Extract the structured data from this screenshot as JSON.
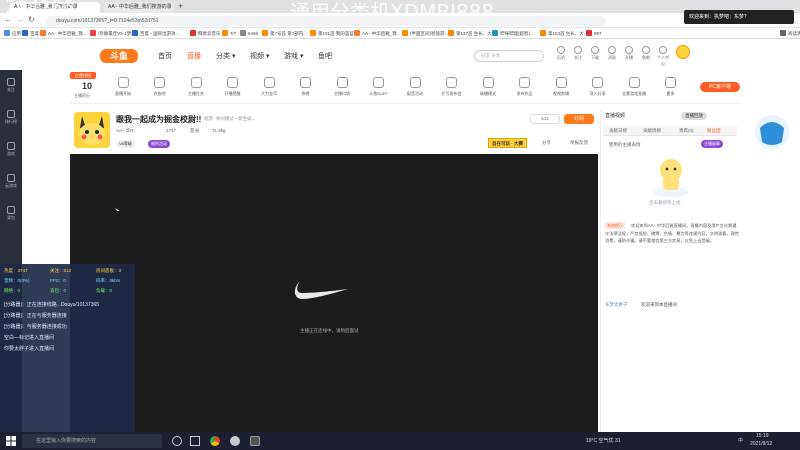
{
  "browser": {
    "tabs": [
      {
        "label": "AA - 中华后雅_我们搜游的录"
      },
      {
        "label": "AA - 中华后雅_我们搜游的录"
      }
    ],
    "new_tab": "+",
    "url": "douyu.com/10137365?_t=0.7124e53m52d751"
  },
  "overlay": {
    "top_number": "204266",
    "top_text": "通用分类机XDMBJ888"
  },
  "notification": {
    "label": "欢迎来到：",
    "name": "执梦吧：东梦？"
  },
  "bookmarks": [
    {
      "label": "应用",
      "color": "#4a8af4"
    },
    {
      "label": "百度",
      "color": "#2a62d4"
    },
    {
      "label": "AA - 中华后雅_我...",
      "color": "#ff7a2d"
    },
    {
      "label": "/奈静最佳V5-1梦想...",
      "color": "#e44"
    },
    {
      "label": "百度 - 国际出游攻...",
      "color": "#2a62d4"
    },
    {
      "label": "网易云音乐",
      "color": "#d33"
    },
    {
      "label": "7/7",
      "color": "#f80"
    },
    {
      "label": "6466",
      "color": "#888"
    },
    {
      "label": "第7号首 第7部内...",
      "color": "#f80"
    },
    {
      "label": "第101首 我的蓝蓝...",
      "color": "#f80"
    },
    {
      "label": "AA - 中华后雅_我...",
      "color": "#ff7a2d"
    },
    {
      "label": "(半面区间)智能游...",
      "color": "#f80"
    },
    {
      "label": "第137首 生长、大...",
      "color": "#f80"
    },
    {
      "label": "哔咪哔哩(超智)...",
      "color": "#29a"
    },
    {
      "label": "第153首 生长、大...",
      "color": "#f80"
    },
    {
      "label": "897",
      "color": "#d33"
    },
    {
      "label": "阅读清单",
      "color": "#666"
    }
  ],
  "site": {
    "logo": "斗鱼",
    "nav": [
      {
        "label": "首页",
        "active": false
      },
      {
        "label": "直播",
        "active": true
      },
      {
        "label": "分类 ▾",
        "active": false
      },
      {
        "label": "视频 ▾",
        "active": false
      },
      {
        "label": "游戏 ▾",
        "active": false
      },
      {
        "label": "鱼吧",
        "active": false
      }
    ],
    "search_placeholder": "好友 分享...",
    "header_icons": [
      "历史",
      "关注",
      "下载",
      "消息",
      "开播",
      "鱼吧",
      "个人中心"
    ]
  },
  "category_bar": {
    "rank_badge": "亿赞排榜",
    "rank_number": "10",
    "rank_label": "主播积分",
    "items": [
      "直播开始",
      "亦鱼吧",
      "主播任务",
      "开播提醒",
      "大力金币",
      "热榜",
      "主播口袋",
      "斗鱼BUFF",
      "配音活动",
      "扩写发布会",
      "联播模式",
      "发布作品",
      "视频剪辑",
      "导入分享",
      "全景游戏直播",
      "更多"
    ],
    "pc_button": "PC客户端"
  },
  "room": {
    "title": "跟我一起成为掘金校尉!!",
    "category": "端游",
    "tags": "休闲模式 • 新生娱...",
    "host": "AA - 华R",
    "viewers": "3747",
    "fans": "亚洲",
    "likes": "71.6kg",
    "badge1": "V6等级",
    "badge2": "福利活动",
    "promo": "自在可玩 · 大赛",
    "share": "分享",
    "report": "举报反馈",
    "subscribe_count": "512",
    "follow": "订阅"
  },
  "video": {
    "loading_text": "主播正在连线中，请稍后面试"
  },
  "sidebar_left": [
    {
      "label": "关注"
    },
    {
      "label": "排行榜"
    },
    {
      "label": "游戏"
    },
    {
      "label": "云游戏"
    },
    {
      "label": "背包"
    }
  ],
  "stats": {
    "row1": [
      {
        "k": "热度：",
        "v": "3747"
      },
      {
        "k": "关注：",
        "v": "513"
      },
      {
        "k": "房间底板：",
        "v": "3"
      }
    ],
    "row2": [
      {
        "k": "音频：",
        "v": "0(0%)"
      },
      {
        "k": "FPS：",
        "v": "0"
      },
      {
        "k": "码率：",
        "v": "0kb/s"
      }
    ],
    "row3": [
      {
        "k": "网络：",
        "v": "0"
      },
      {
        "k": "丢包：",
        "v": "0"
      },
      {
        "k": "负载：",
        "v": "0"
      }
    ],
    "log": [
      "[分路器]：正在连接线路...Douyu/10137365",
      "[分路器]：正在与服务器连接",
      "[分路器]：与服务器连接成功",
      "空白—标记进入直播间",
      "你要太胖子进入直播间"
    ]
  },
  "right_panel": {
    "tabs": [
      "贡献日榜",
      "贡献周榜",
      "贵宾(0)",
      "粉丝团"
    ],
    "rank_label": "直播视频",
    "rank_link": "直播回放",
    "subtitle": "使用的主播表情",
    "mini_badge": "主播勋章",
    "empty_hint": "还未看榜单上榜",
    "notice_tag": "系统提示",
    "notice": "欢迎来到AA - 中华后雅直播间，直播内容及用户言论需遵守法律法规，严禁低俗、赌博、色情、暴力等违规内容。文明观看，理性消费，谨防诈骗。请不要相信第三方交易，以免上当受骗。",
    "chat_user": "东梦太胖子",
    "chat_text": "欢迎来到本直播间",
    "promo_text": "王者荣耀"
  },
  "taskbar": {
    "search_placeholder": "在这里输入你要搜索的内容",
    "weather": "19°C 空气优 31",
    "time": "15:19",
    "date": "2021/9/12",
    "lang": "中"
  }
}
